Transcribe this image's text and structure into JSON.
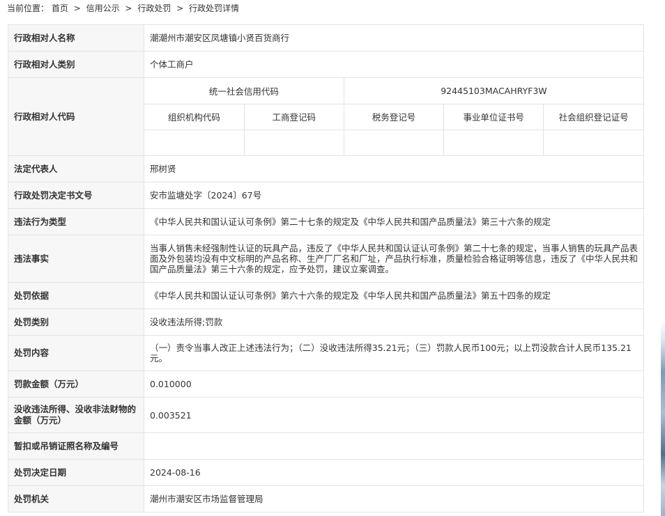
{
  "breadcrumb": {
    "prefix": "当前位置：",
    "items": [
      "首页",
      "信用公示",
      "行政处罚",
      "行政处罚详情"
    ],
    "separator": ">"
  },
  "rows": {
    "name": {
      "label": "行政相对人名称",
      "value": "潮潮州市潮安区凤塘镇小贤百货商行"
    },
    "category": {
      "label": "行政相对人类别",
      "value": "个体工商户"
    },
    "code": {
      "label": "行政相对人代码",
      "uscc_label": "统一社会信用代码",
      "uscc_value": "92445103MACAHRYF3W",
      "headers": [
        "组织机构代码",
        "工商登记码",
        "税务登记号",
        "事业单位证书号",
        "社会组织登记证号"
      ],
      "values": [
        "",
        "",
        "",
        "",
        ""
      ]
    },
    "legal_rep": {
      "label": "法定代表人",
      "value": "邢树贤"
    },
    "doc_no": {
      "label": "行政处罚决定书文号",
      "value": "安市监塘处字〔2024〕67号"
    },
    "violation_type": {
      "label": "违法行为类型",
      "value": "《中华人民共和国认证认可条例》第二十七条的规定及《中华人民共和国产品质量法》第三十六条的规定"
    },
    "facts": {
      "label": "违法事实",
      "value": "当事人销售未经强制性认证的玩具产品，违反了《中华人民共和国认证认可条例》第二十七条的规定，当事人销售的玩具产品表面及外包装均没有中文标明的产品名称、生产厂厂名和厂址，产品执行标准，质量检验合格证明等信息，违反了《中华人民共和国产品质量法》第三十六条的规定，应予处罚，建议立案调查。"
    },
    "basis": {
      "label": "处罚依据",
      "value": "《中华人民共和国认证认可条例》第六十六条的规定及《中华人民共和国产品质量法》第五十四条的规定"
    },
    "penalty_type": {
      "label": "处罚类别",
      "value": "没收违法所得;罚款"
    },
    "content": {
      "label": "处罚内容",
      "value": "（一）责令当事人改正上述违法行为；（二）没收违法所得35.21元；（三）罚款人民币100元；以上罚没款合计人民币135.21元。"
    },
    "fine": {
      "label": "罚款金额（万元）",
      "value": "0.010000"
    },
    "confiscation": {
      "label": "没收违法所得、没收非法财物的金额（万元）",
      "value": "0.003521"
    },
    "license": {
      "label": "暂扣或吊销证照名称及编号",
      "value": ""
    },
    "date": {
      "label": "处罚决定日期",
      "value": "2024-08-16"
    },
    "authority": {
      "label": "处罚机关",
      "value": "潮州市潮安区市场监督管理局"
    }
  }
}
